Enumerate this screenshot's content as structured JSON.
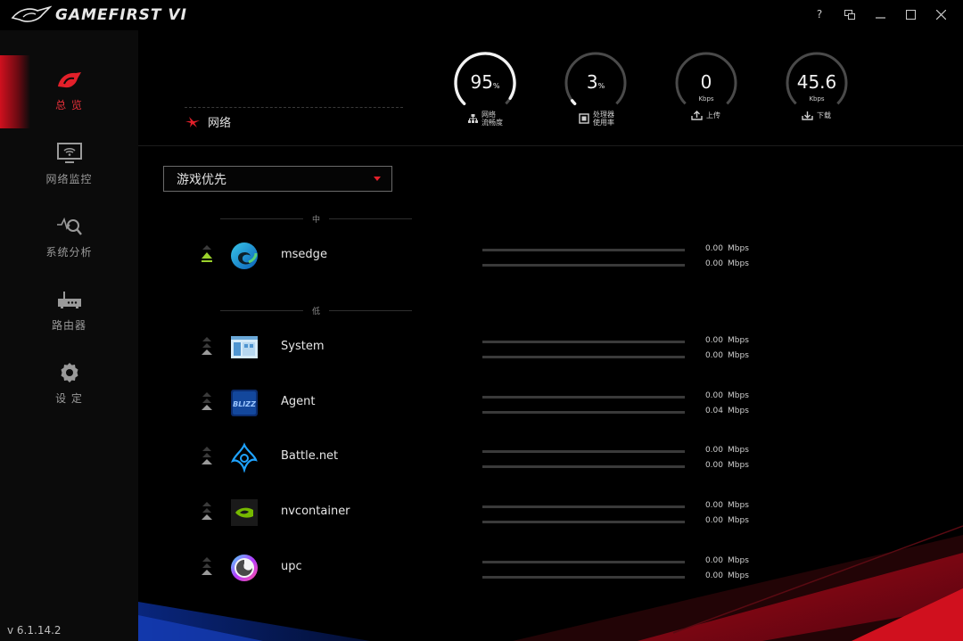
{
  "app": {
    "title": "GAMEFIRST VI",
    "version": "v 6.1.14.2"
  },
  "window_controls": {
    "help": "?"
  },
  "sidebar": {
    "items": [
      {
        "label": "总 览",
        "icon": "rog-overview-icon",
        "active": true
      },
      {
        "label": "网络监控",
        "icon": "monitor-icon"
      },
      {
        "label": "系统分析",
        "icon": "analysis-search-icon"
      },
      {
        "label": "路由器",
        "icon": "router-icon"
      },
      {
        "label": "设 定",
        "icon": "gear-icon"
      }
    ]
  },
  "header": {
    "section_title": "网络",
    "gauges": [
      {
        "value": "95",
        "suffix": "%",
        "unit": "",
        "caption": "网络\n流畅度",
        "fill": 0.95
      },
      {
        "value": "3",
        "suffix": "%",
        "unit": "",
        "caption": "处理器\n使用率",
        "fill": 0.03
      },
      {
        "value": "0",
        "suffix": "",
        "unit": "Kbps",
        "caption": "上传",
        "fill": 0
      },
      {
        "value": "45.6",
        "suffix": "",
        "unit": "Kbps",
        "caption": "下载",
        "fill": 0
      }
    ]
  },
  "mode_select": {
    "value": "游戏优先"
  },
  "priority_groups": {
    "medium": "中",
    "low": "低"
  },
  "apps": [
    {
      "name": "msedge",
      "up": "0.00",
      "down": "0.00",
      "unit": "Mbps",
      "icon": "edge-icon",
      "group": "medium"
    },
    {
      "name": "System",
      "up": "0.00",
      "down": "0.00",
      "unit": "Mbps",
      "icon": "system-window-icon",
      "group": "low"
    },
    {
      "name": "Agent",
      "up": "0.00",
      "down": "0.04",
      "unit": "Mbps",
      "icon": "blizzard-icon",
      "group": "low"
    },
    {
      "name": "Battle.net",
      "up": "0.00",
      "down": "0.00",
      "unit": "Mbps",
      "icon": "battlenet-icon",
      "group": "low"
    },
    {
      "name": "nvcontainer",
      "up": "0.00",
      "down": "0.00",
      "unit": "Mbps",
      "icon": "nvidia-icon",
      "group": "low"
    },
    {
      "name": "upc",
      "up": "0.00",
      "down": "0.00",
      "unit": "Mbps",
      "icon": "ubisoft-icon",
      "group": "low"
    }
  ],
  "colors": {
    "accent": "#e3202a",
    "priority_medium": "#9ad12b",
    "priority_low": "#8a8a8a"
  }
}
